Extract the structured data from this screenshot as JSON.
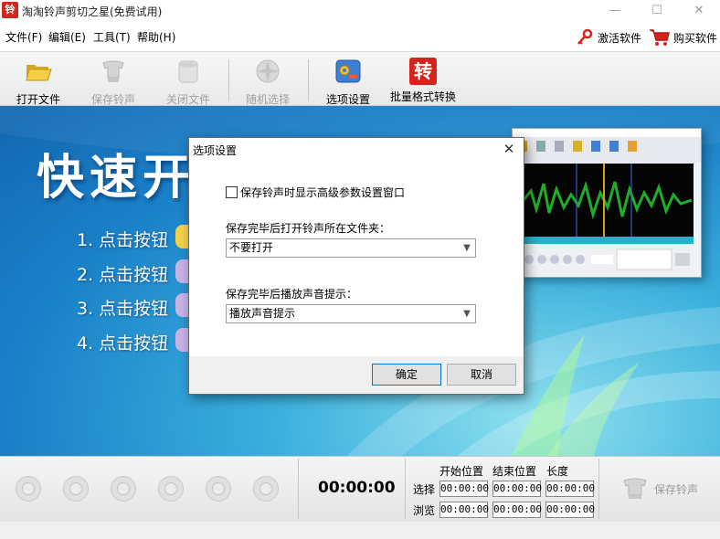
{
  "window": {
    "title": "淘淘铃声剪切之星(免费试用)",
    "app_icon": "铃",
    "minimize": "—",
    "maximize": "☐",
    "close": "✕"
  },
  "menu": {
    "items": [
      "文件(F)",
      "编辑(E)",
      "工具(T)",
      "帮助(H)"
    ],
    "activate": "激活软件",
    "buy": "购买软件"
  },
  "toolbar": {
    "open": "打开文件",
    "save": "保存铃声",
    "close": "关闭文件",
    "random": "随机选择",
    "options": "选项设置",
    "batch": "批量格式转换",
    "batch_icon_glyph": "转"
  },
  "main": {
    "title": "快速开始",
    "steps": [
      "1.  点击按钮",
      "2.  点击按钮",
      "3.  点击按钮",
      "4.  点击按钮"
    ]
  },
  "dialog": {
    "title": "选项设置",
    "close": "✕",
    "checkbox_label": "保存铃声时显示高级参数设置窗口",
    "folder_label": "保存完毕后打开铃声所在文件夹：",
    "folder_value": "不要打开",
    "sound_label": "保存完毕后播放声音提示：",
    "sound_value": "播放声音提示",
    "ok": "确定",
    "cancel": "取消"
  },
  "bottom": {
    "time": "00:00:00",
    "headers": [
      "开始位置",
      "结束位置",
      "长度"
    ],
    "rows": [
      {
        "label": "选择",
        "values": [
          "00:00:00",
          "00:00:00",
          "00:00:00"
        ]
      },
      {
        "label": "浏览",
        "values": [
          "00:00:00",
          "00:00:00",
          "00:00:00"
        ]
      }
    ],
    "save": "保存铃声"
  },
  "icons": [
    "folder-open-icon",
    "save-ringtone-icon",
    "close-file-icon",
    "random-select-icon",
    "options-icon",
    "batch-convert-icon",
    "key-icon",
    "cart-icon"
  ],
  "colors": {
    "accent_red": "#d6231c",
    "dialog_focus": "#0078d7",
    "main_bg": "#1a80c8"
  }
}
